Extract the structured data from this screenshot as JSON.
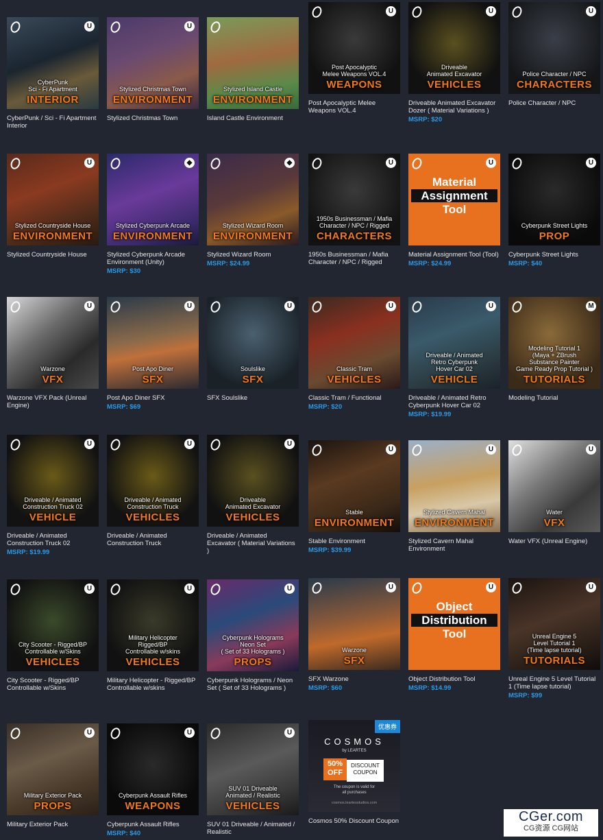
{
  "products": [
    {
      "title": "CyberPunk / Sci - Fi Apartment Interior",
      "price": "",
      "sub": "CyberPunk\nSci - Fi Apartment",
      "cat": "INTERIOR",
      "engine": "unreal",
      "bg": "linear-gradient(160deg,#3a4a5a 0%,#1a2530 45%,#6a5a3a 70%,#2a3a40 100%)"
    },
    {
      "title": "Stylized Christmas Town",
      "price": "",
      "sub": "Stylized Christmas Town",
      "cat": "ENVIRONMENT",
      "engine": "unreal",
      "bg": "linear-gradient(160deg,#4a3a6a 0%,#6a4a70 40%,#8a5a4a 70%,#3a2a40 100%)"
    },
    {
      "title": "Island Castle Environment",
      "price": "",
      "sub": "Stylized Island Castle",
      "cat": "ENVIRONMENT",
      "engine": "",
      "bg": "linear-gradient(170deg,#7a9a5a 0%,#a06a40 45%,#5a8a4a 75%,#3a6a3a 100%)"
    },
    {
      "title": "Post Apocalyptic Melee Weapons VOL.4",
      "price": "",
      "sub": "Post Apocalyptic\nMelee Weapons VOL.4",
      "cat": "WEAPONS",
      "engine": "unreal",
      "bg": "radial-gradient(circle at 50% 40%,#3a3a3a 0%,#111 70%)"
    },
    {
      "title": "Driveable Animated Excavator Dozer ( Material Variations )",
      "price": "MSRP: $20",
      "sub": "Driveable\nAnimated Excavator",
      "cat": "VEHICLES",
      "engine": "unreal",
      "bg": "radial-gradient(circle at 50% 45%,#5a5020 0%,#111 70%)"
    },
    {
      "title": "Police Character / NPC",
      "price": "",
      "sub": "Police Character / NPC",
      "cat": "CHARACTERS",
      "engine": "unreal",
      "bg": "radial-gradient(circle at 50% 40%,#3a3e48 0%,#141618 75%)"
    },
    {
      "title": "Stylized Countryside House",
      "price": "",
      "sub": "Stylized Countryside House",
      "cat": "ENVIRONMENT",
      "engine": "unreal",
      "bg": "linear-gradient(160deg,#5a2a1a 0%,#8a3a20 40%,#4a2a1a 75%,#2a1a10 100%)"
    },
    {
      "title": "Stylized Cyberpunk Arcade Environment (Unity)",
      "price": "MSRP: $30",
      "sub": "Stylized Cyberpunk Arcade",
      "cat": "ENVIRONMENT",
      "engine": "unity",
      "bg": "linear-gradient(160deg,#2a2a6a 0%,#6a3a9a 45%,#3a2a6a 80%,#1a1a3a 100%)"
    },
    {
      "title": "Stylized Wizard Room",
      "price": "MSRP: $24.99",
      "sub": "Stylized Wizard Room",
      "cat": "ENVIRONMENT",
      "engine": "unity",
      "bg": "linear-gradient(160deg,#3a2a4a 0%,#5a3a3a 45%,#8a5a2a 70%,#2a1a20 100%)"
    },
    {
      "title": "1950s Businessman / Mafia Character / NPC / Rigged",
      "price": "",
      "sub": "1950s Businessman / Mafia\nCharacter / NPC / Rigged",
      "cat": "CHARACTERS",
      "engine": "unreal",
      "bg": "radial-gradient(circle at 50% 40%,#3a3a3a 0%,#121212 75%)"
    },
    {
      "title": "Material Assignment Tool (Tool)",
      "price": "MSRP: $24.99",
      "sub": "",
      "cat": "",
      "engine": "unreal",
      "bg": "#e8711f",
      "big": "Material\nAssignment\nTool"
    },
    {
      "title": "Cyberpunk Street Lights",
      "price": "MSRP: $40",
      "sub": "Cyberpunk Street Lights",
      "cat": "PROP",
      "engine": "unreal",
      "bg": "radial-gradient(circle at 50% 40%,#2a2a2a 0%,#0a0a0a 75%)"
    },
    {
      "title": "Warzone VFX Pack (Unreal Engine)",
      "price": "",
      "sub": "Warzone",
      "cat": "VFX",
      "engine": "unreal",
      "bg": "linear-gradient(140deg,#d8d8d8 0%,#6a6a6a 40%,#2a2a2a 70%,#4a4a4a 100%)"
    },
    {
      "title": "Post Apo Diner SFX",
      "price": "MSRP: $69",
      "sub": "Post Apo Diner",
      "cat": "SFX",
      "engine": "unreal",
      "bg": "linear-gradient(170deg,#2a3a4a 0%,#8a6a4a 45%,#c0703a 60%,#2a2a30 100%)"
    },
    {
      "title": "SFX Soulslike",
      "price": "",
      "sub": "Soulslike",
      "cat": "SFX",
      "engine": "unreal",
      "bg": "radial-gradient(circle at 50% 40%,#4a6070 0%,#1a2228 75%)"
    },
    {
      "title": "Classic Tram / Functional",
      "price": "MSRP: $20",
      "sub": "Classic Tram",
      "cat": "VEHICLES",
      "engine": "unreal",
      "bg": "linear-gradient(160deg,#3a2a20 0%,#8a3020 40%,#6a4a30 70%,#2a1a18 100%)"
    },
    {
      "title": "Driveable / Animated Retro Cyberpunk Hover Car 02",
      "price": "MSRP: $19.99",
      "sub": "Driveable / Animated\nRetro Cyberpunk\nHover Car 02",
      "cat": "VEHICLE",
      "engine": "unreal",
      "bg": "linear-gradient(160deg,#2a3a4a 0%,#3a5a6a 40%,#2a3a40 75%,#1a2228 100%)"
    },
    {
      "title": "Modeling Tutorial",
      "price": "",
      "sub": "Modeling Tutorial 1\n(Maya + ZBrush\nSubstance Painter\nGame Ready Prop Tutorial )",
      "cat": "TUTORIALS",
      "engine": "maya",
      "bg": "radial-gradient(circle at 45% 40%,#8a6a3a 0%,#3a2a18 75%)"
    },
    {
      "title": "Driveable / Animated Construction Truck 02",
      "price": "MSRP: $19.99",
      "sub": "Driveable / Animated\nConstruction Truck 02",
      "cat": "VEHICLE",
      "engine": "unreal",
      "bg": "radial-gradient(circle at 50% 45%,#6a5a18 0%,#121212 72%)"
    },
    {
      "title": "Driveable / Animated Construction Truck",
      "price": "",
      "sub": "Driveable / Animated\nConstruction Truck",
      "cat": "VEHICLES",
      "engine": "unreal",
      "bg": "radial-gradient(circle at 50% 45%,#6a5a18 0%,#121212 72%)"
    },
    {
      "title": "Driveable / Animated Excavator ( Material Variations )",
      "price": "",
      "sub": "Driveable\nAnimated Excavator",
      "cat": "VEHICLES",
      "engine": "unreal",
      "bg": "radial-gradient(circle at 50% 45%,#5a5020 0%,#111 72%)"
    },
    {
      "title": "Stable Environment",
      "price": "MSRP: $39.99",
      "sub": "Stable",
      "cat": "ENVIRONMENT",
      "engine": "unreal",
      "bg": "linear-gradient(160deg,#1a1410 0%,#5a3a20 40%,#3a2818 75%,#120e0a 100%)"
    },
    {
      "title": "Stylized Cavern Mahal Environment",
      "price": "",
      "sub": "Stylized Cavern Mahal",
      "cat": "ENVIRONMENT",
      "engine": "unreal",
      "bg": "linear-gradient(170deg,#9ab0c8 0%,#c8a060 45%,#d8c8a8 70%,#8a7050 100%)"
    },
    {
      "title": "Water VFX (Unreal Engine)",
      "price": "",
      "sub": "Water",
      "cat": "VFX",
      "engine": "unreal",
      "bg": "linear-gradient(140deg,#e0e0e0 0%,#7a7a7a 40%,#3a3a3a 70%,#5a5a5a 100%)"
    },
    {
      "title": "City Scooter - Rigged/BP Controllable w/Skins",
      "price": "",
      "sub": "City Scooter - Rigged/BP\nControllable w/Skins",
      "cat": "VEHICLES",
      "engine": "unreal",
      "bg": "radial-gradient(circle at 50% 45%,#3a4a2a 0%,#111 72%)"
    },
    {
      "title": "Military Helicopter - Rigged/BP Controllable w/skins",
      "price": "",
      "sub": "Military Helicopter\nRigged/BP\nControllable w/skins",
      "cat": "VEHICLES",
      "engine": "unreal",
      "bg": "radial-gradient(circle at 50% 45%,#3a3a2a 0%,#111 72%)"
    },
    {
      "title": "Cyberpunk Holograms / Neon Set ( Set of 33 Holograms )",
      "price": "",
      "sub": "Cyberpunk Holograms\nNeon Set\n( Set of 33 Holograms )",
      "cat": "PROPS",
      "engine": "unreal",
      "bg": "linear-gradient(160deg,#6a2a6a 0%,#2a4a7a 40%,#8a3a5a 70%,#1a1a3a 100%)"
    },
    {
      "title": "SFX Warzone",
      "price": "MSRP: $60",
      "sub": "Warzone",
      "cat": "SFX",
      "engine": "unreal",
      "bg": "linear-gradient(170deg,#2a3a4a 0%,#8a5a3a 45%,#c06a2a 65%,#3a2a20 100%)"
    },
    {
      "title": "Object Distribution Tool",
      "price": "MSRP: $14.99",
      "sub": "",
      "cat": "",
      "engine": "unreal",
      "bg": "#e8711f",
      "big": "Object\nDistribution\nTool"
    },
    {
      "title": "Unreal Engine 5 Level Tutorial 1 (Time lapse tutorial)",
      "price": "MSRP: $99",
      "sub": "Unreal Engine 5\nLevel Tutorial 1\n(Time lapse tutorial)",
      "cat": "TUTORIALS",
      "engine": "unreal",
      "bg": "linear-gradient(160deg,#1a1410 0%,#4a3428 45%,#2a2018 75%,#100c0a 100%)"
    },
    {
      "title": "Military Exterior Pack",
      "price": "",
      "sub": "Military Exterior Pack",
      "cat": "PROPS",
      "engine": "unreal",
      "bg": "linear-gradient(160deg,#3a3028 0%,#6a5a48 40%,#4a3a2a 70%,#2a2018 100%)"
    },
    {
      "title": "Cyberpunk Assault Rifles",
      "price": "MSRP: $40",
      "sub": "Cyberpunk Assault Rifles",
      "cat": "WEAPONS",
      "engine": "unreal",
      "bg": "radial-gradient(circle at 50% 45%,#2a2a2a 0%,#0a0a0a 72%)"
    },
    {
      "title": "SUV 01 Driveable / Animated / Realistic",
      "price": "",
      "sub": "SUV 01 Driveable\nAnimated / Realistic",
      "cat": "VEHICLES",
      "engine": "unreal",
      "bg": "linear-gradient(160deg,#2a2a2a 0%,#5a5a5a 45%,#3a3a3a 75%,#1a1a1a 100%)"
    }
  ],
  "coupon": {
    "title": "Cosmos 50% Discount Coupon",
    "badge": "优惠券",
    "brand": "COSMOS",
    "brand_by": "by LEARTES",
    "percent": "50%\nOFF",
    "discount": "DISCOUNT\nCOUPON",
    "note": "The coupon is valid for\nall purchases",
    "url": "cosmos.leartesstudios.com"
  },
  "watermark": {
    "main": "CGer.com",
    "sub": "CG资源 CG网站"
  },
  "colors": {
    "background": "#222630",
    "price": "#2c9be8",
    "category": "#f07a1a",
    "tool_orange": "#e8711f"
  }
}
